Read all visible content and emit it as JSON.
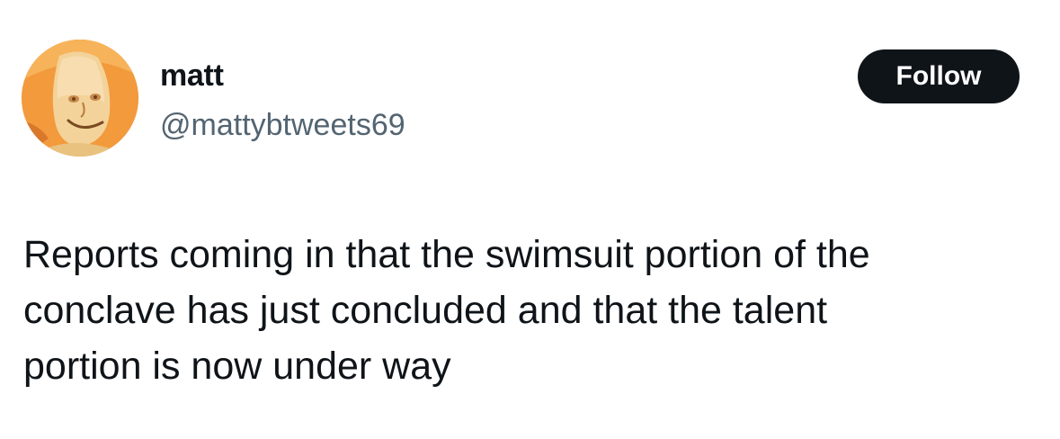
{
  "author": {
    "display_name": "matt",
    "handle": "@mattybtweets69",
    "avatar_icon": "cartoon-face-avatar"
  },
  "follow_button": {
    "label": "Follow"
  },
  "tweet": {
    "lines": [
      "Reports coming in that the swimsuit portion of the",
      "conclave has just concluded and that the talent",
      "portion is now under way"
    ]
  },
  "colors": {
    "text": "#0f1419",
    "secondary_text": "#536471",
    "button_bg": "#0f1419",
    "button_text": "#ffffff",
    "avatar_bg": "#f29a3c"
  }
}
